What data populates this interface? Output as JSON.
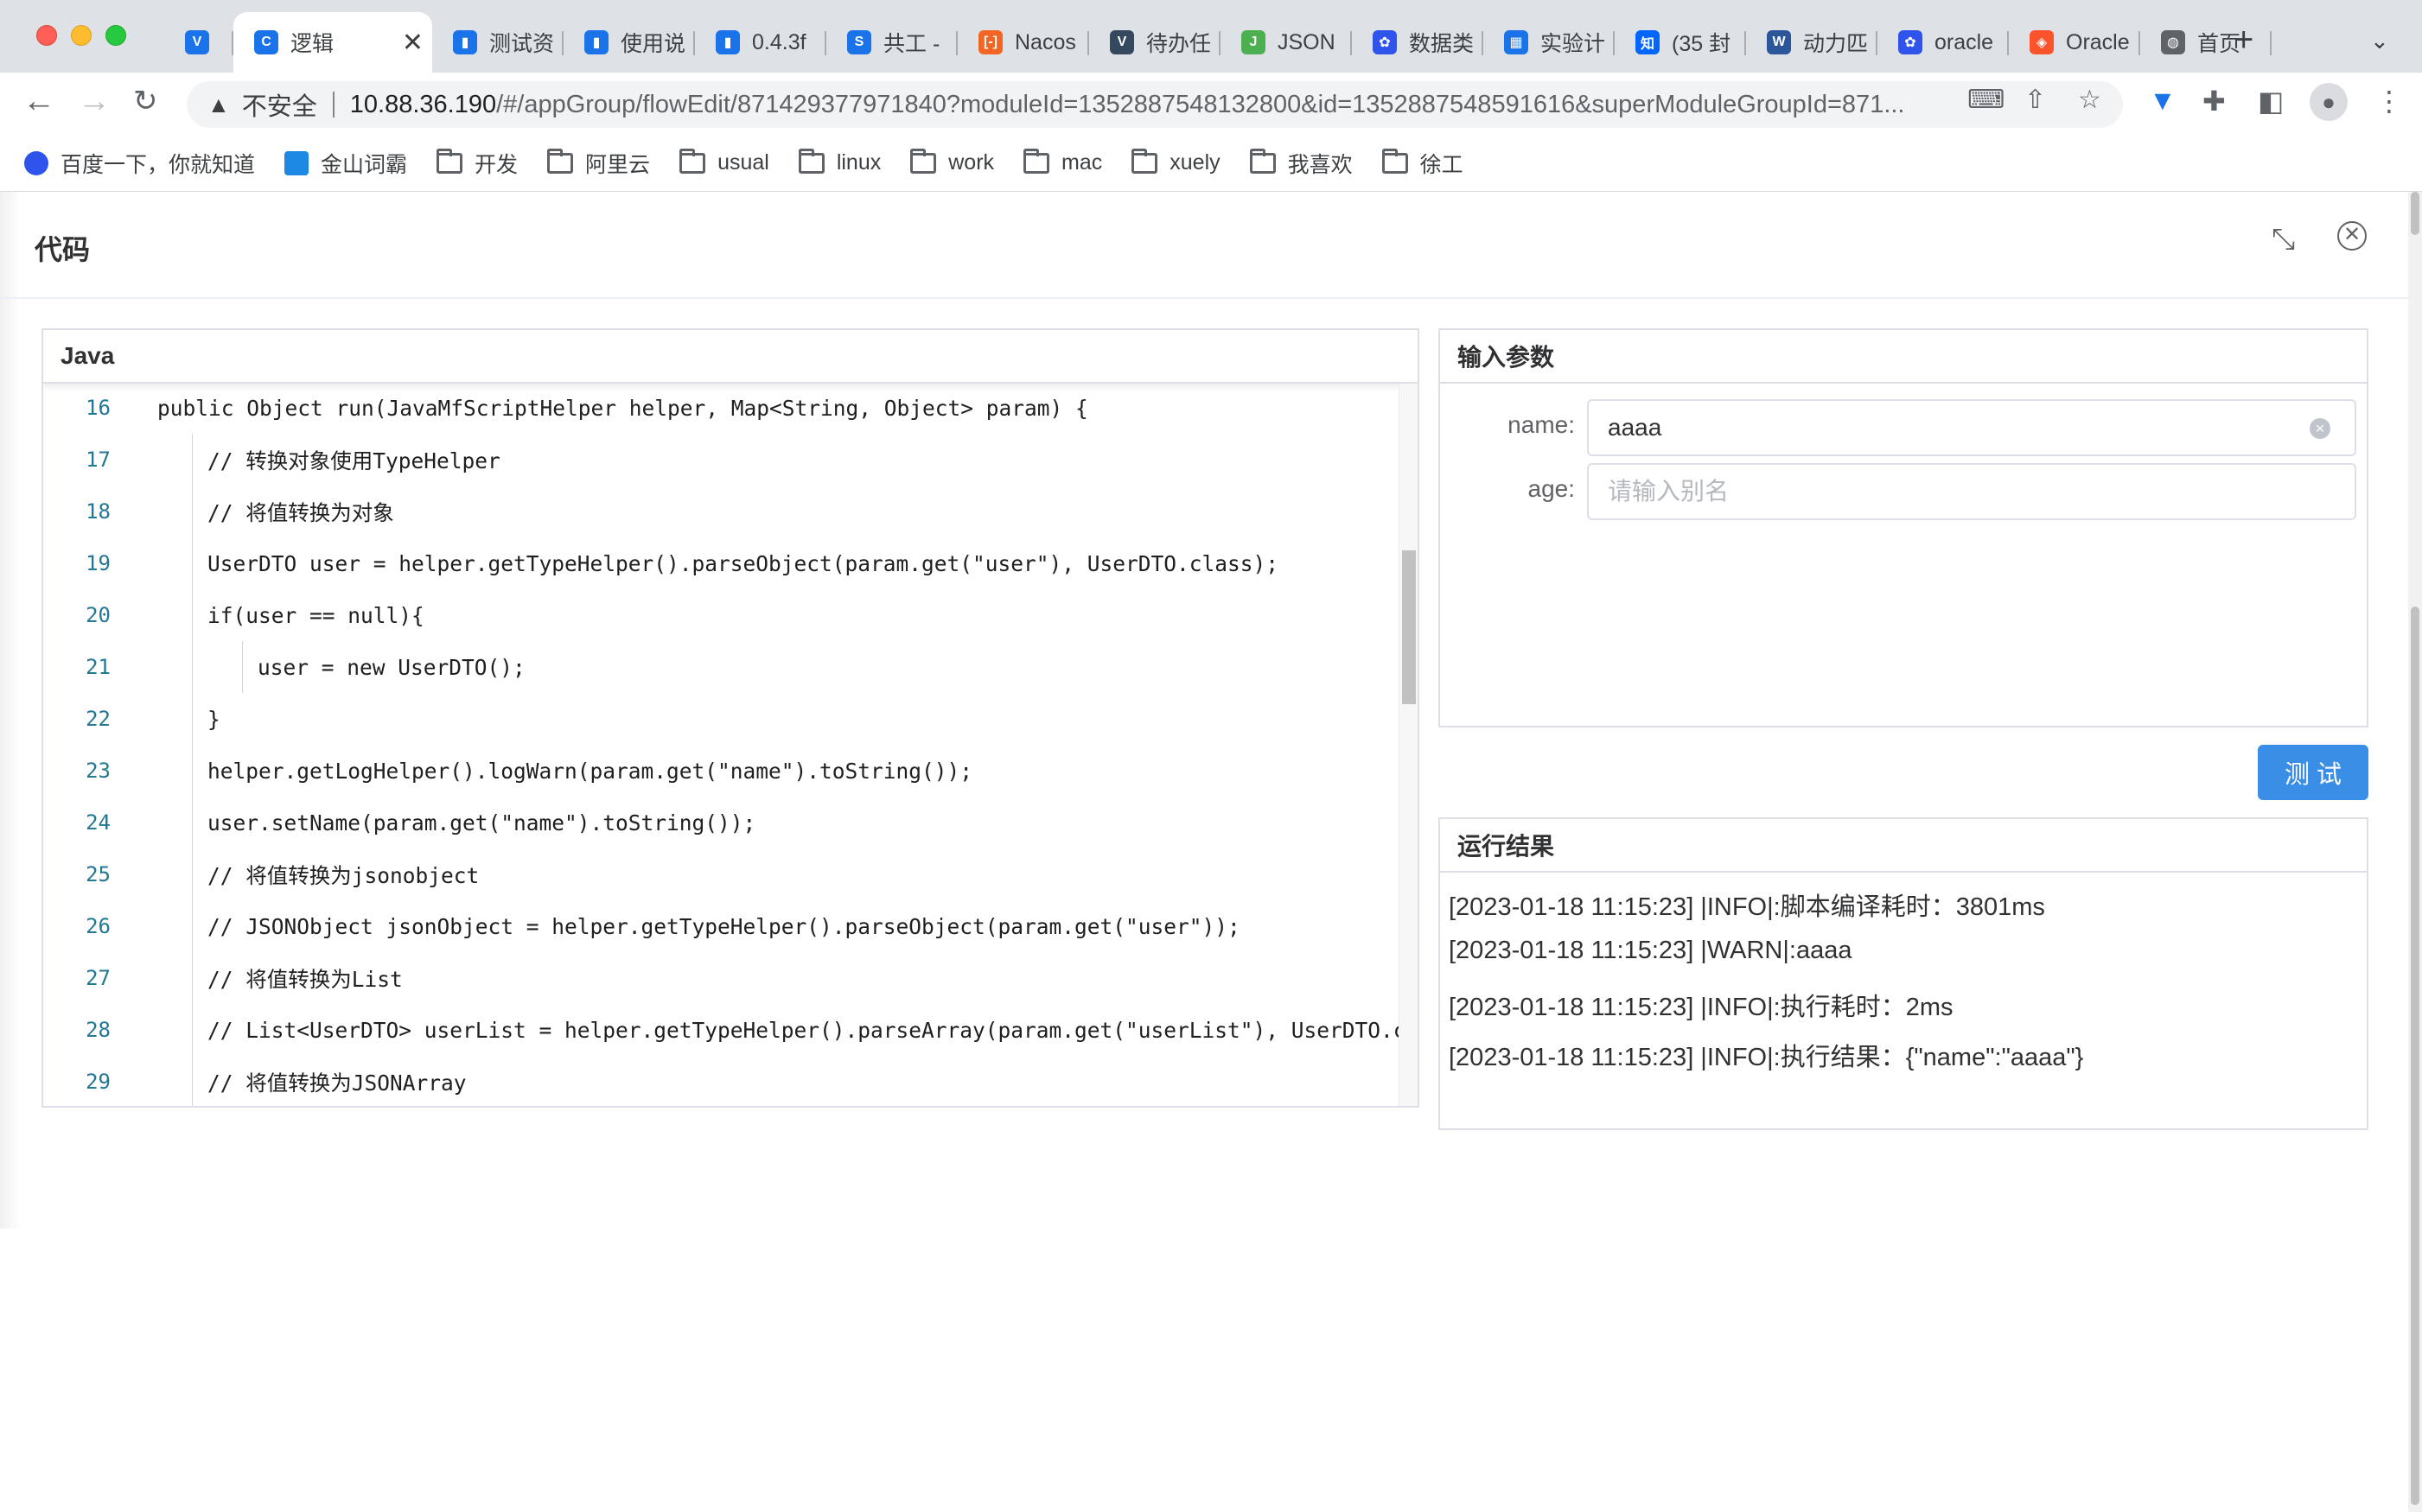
{
  "browser": {
    "tabs": [
      {
        "title": "",
        "icon": "vee-icon",
        "color": "#1a73e8"
      },
      {
        "title": "逻辑",
        "icon": "logic-app-icon",
        "color": "#1a73e8",
        "active": true
      },
      {
        "title": "测试资",
        "icon": "doc-icon",
        "color": "#1a73e8"
      },
      {
        "title": "使用说",
        "icon": "doc-icon",
        "color": "#1a73e8"
      },
      {
        "title": "0.4.3f",
        "icon": "doc-icon",
        "color": "#1a73e8"
      },
      {
        "title": "共工 -",
        "icon": "s-icon",
        "color": "#1a73e8"
      },
      {
        "title": "Nacos",
        "icon": "nacos-icon",
        "color": "#f26522"
      },
      {
        "title": "待办任",
        "icon": "vue-icon",
        "color": "#35495e"
      },
      {
        "title": "JSON",
        "icon": "json-icon",
        "color": "#4caf50"
      },
      {
        "title": "数据类",
        "icon": "baidu-icon",
        "color": "#2f54eb"
      },
      {
        "title": "实验计",
        "icon": "grid-icon",
        "color": "#1a73e8"
      },
      {
        "title": "(35 封",
        "icon": "zhihu-icon",
        "color": "#0066ff"
      },
      {
        "title": "动力匹",
        "icon": "word-icon",
        "color": "#2b579a"
      },
      {
        "title": "oracle",
        "icon": "baidu-icon",
        "color": "#2f54eb"
      },
      {
        "title": "Oracle",
        "icon": "brave-icon",
        "color": "#fb542b"
      },
      {
        "title": "首页",
        "icon": "globe-icon",
        "color": "#5f6368"
      }
    ],
    "active_tab_close": "✕",
    "new_tab": "+",
    "address": {
      "insecure_label": "不安全",
      "host": "10.88.36.190",
      "rest": "/#/appGroup/flowEdit/871429377971840?moduleId=1352887548132800&id=1352887548591616&superModuleGroupId=871..."
    },
    "bookmarks": [
      {
        "label": "百度一下，你就知道",
        "icon": "baidu-icon"
      },
      {
        "label": "金山词霸",
        "icon": "jinshan-icon"
      },
      {
        "label": "开发",
        "icon": "folder-icon"
      },
      {
        "label": "阿里云",
        "icon": "folder-icon"
      },
      {
        "label": "usual",
        "icon": "folder-icon"
      },
      {
        "label": "linux",
        "icon": "folder-icon"
      },
      {
        "label": "work",
        "icon": "folder-icon"
      },
      {
        "label": "mac",
        "icon": "folder-icon"
      },
      {
        "label": "xuely",
        "icon": "folder-icon"
      },
      {
        "label": "我喜欢",
        "icon": "folder-icon"
      },
      {
        "label": "徐工",
        "icon": "folder-icon"
      }
    ]
  },
  "dialog": {
    "title": "代码",
    "code_panel": {
      "language": "Java",
      "lines": [
        {
          "n": "16",
          "indent": 1,
          "text": "public Object run(JavaMfScriptHelper helper, Map<String, Object> param) {"
        },
        {
          "n": "17",
          "indent": 2,
          "text": "// 转换对象使用TypeHelper"
        },
        {
          "n": "18",
          "indent": 2,
          "text": "// 将值转换为对象"
        },
        {
          "n": "19",
          "indent": 2,
          "text": "UserDTO user = helper.getTypeHelper().parseObject(param.get(\"user\"), UserDTO.class);"
        },
        {
          "n": "20",
          "indent": 2,
          "text": "if(user == null){"
        },
        {
          "n": "21",
          "indent": 3,
          "text": "user = new UserDTO();"
        },
        {
          "n": "22",
          "indent": 2,
          "text": "}"
        },
        {
          "n": "23",
          "indent": 2,
          "text": "helper.getLogHelper().logWarn(param.get(\"name\").toString());"
        },
        {
          "n": "24",
          "indent": 2,
          "text": "user.setName(param.get(\"name\").toString());"
        },
        {
          "n": "25",
          "indent": 2,
          "text": "// 将值转换为jsonobject"
        },
        {
          "n": "26",
          "indent": 2,
          "text": "// JSONObject jsonObject = helper.getTypeHelper().parseObject(param.get(\"user\"));"
        },
        {
          "n": "27",
          "indent": 2,
          "text": "// 将值转换为List"
        },
        {
          "n": "28",
          "indent": 2,
          "text": "// List<UserDTO> userList = helper.getTypeHelper().parseArray(param.get(\"userList\"), UserDTO.cl"
        },
        {
          "n": "29",
          "indent": 2,
          "text": "// 将值转换为JSONArray"
        }
      ]
    },
    "params_panel": {
      "title": "输入参数",
      "fields": [
        {
          "label": "name:",
          "value": "aaaa",
          "placeholder": ""
        },
        {
          "label": "age:",
          "value": "",
          "placeholder": "请输入别名"
        }
      ]
    },
    "test_button": "测试",
    "result_panel": {
      "title": "运行结果",
      "logs": [
        "[2023-01-18 11:15:23] |INFO|:脚本编译耗时：3801ms",
        "[2023-01-18 11:15:23] |WARN|:aaaa",
        "[2023-01-18 11:15:23] |INFO|:执行耗时：2ms",
        "[2023-01-18 11:15:23] |INFO|:执行结果：{\"name\":\"aaaa\"}"
      ]
    }
  }
}
